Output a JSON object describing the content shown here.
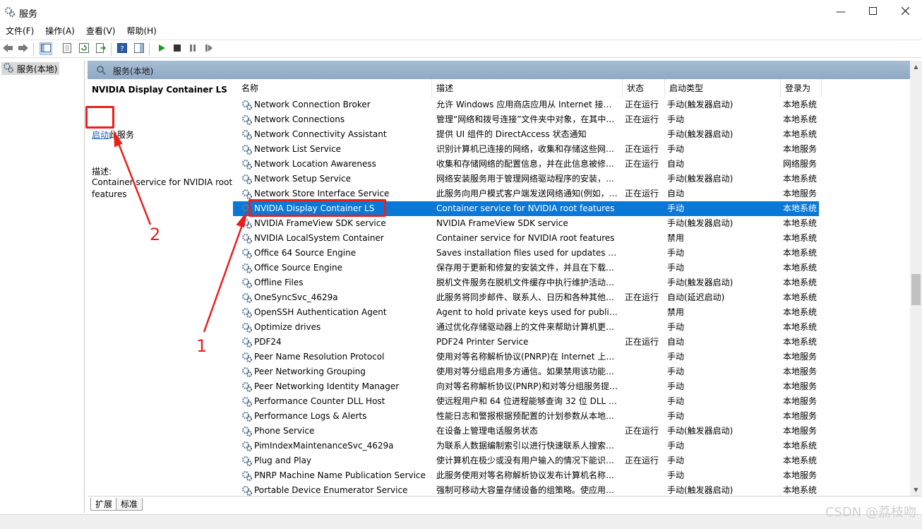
{
  "window": {
    "title": "服务"
  },
  "menu": [
    "文件(F)",
    "操作(A)",
    "查看(V)",
    "帮助(H)"
  ],
  "tree": {
    "root": "服务(本地)"
  },
  "main_header": "服务(本地)",
  "detail": {
    "title": "NVIDIA Display Container LS",
    "action_link": "启动",
    "action_suffix": "此服务",
    "desc_label": "描述:",
    "desc_text": "Container service for NVIDIA root features"
  },
  "columns": [
    "名称",
    "描述",
    "状态",
    "启动类型",
    "登录为"
  ],
  "services": [
    {
      "name": "Network Connection Broker",
      "desc": "允许 Windows 应用商店应用从 Internet 接收…",
      "status": "正在运行",
      "startup": "手动(触发器启动)",
      "logon": "本地系统"
    },
    {
      "name": "Network Connections",
      "desc": "管理“网络和拨号连接”文件夹中对象，在其中…",
      "status": "正在运行",
      "startup": "手动",
      "logon": "本地系统"
    },
    {
      "name": "Network Connectivity Assistant",
      "desc": "提供 UI 组件的 DirectAccess 状态通知",
      "status": "",
      "startup": "手动(触发器启动)",
      "logon": "本地系统"
    },
    {
      "name": "Network List Service",
      "desc": "识别计算机已连接的网络，收集和存储这些网…",
      "status": "正在运行",
      "startup": "手动",
      "logon": "本地服务"
    },
    {
      "name": "Network Location Awareness",
      "desc": "收集和存储网络的配置信息，并在此信息被修…",
      "status": "正在运行",
      "startup": "自动",
      "logon": "网络服务"
    },
    {
      "name": "Network Setup Service",
      "desc": "网络安装服务用于管理网络驱动程序的安装，…",
      "status": "",
      "startup": "手动(触发器启动)",
      "logon": "本地系统"
    },
    {
      "name": "Network Store Interface Service",
      "desc": "此服务向用户模式客户端发送网络通知(例如，…",
      "status": "正在运行",
      "startup": "自动",
      "logon": "本地服务"
    },
    {
      "name": "NVIDIA Display Container LS",
      "desc": "Container service for NVIDIA root features",
      "status": "",
      "startup": "手动",
      "logon": "本地系统",
      "selected": true
    },
    {
      "name": "NVIDIA FrameView SDK service",
      "desc": "NVIDIA FrameView SDK service",
      "status": "",
      "startup": "手动(触发器启动)",
      "logon": "本地系统"
    },
    {
      "name": "NVIDIA LocalSystem Container",
      "desc": "Container service for NVIDIA root features",
      "status": "",
      "startup": "禁用",
      "logon": "本地系统"
    },
    {
      "name": "Office 64 Source Engine",
      "desc": "Saves installation files used for updates a…",
      "status": "",
      "startup": "手动",
      "logon": "本地系统"
    },
    {
      "name": "Office Source Engine",
      "desc": "保存用于更新和修复的安装文件，并且在下载…",
      "status": "",
      "startup": "手动",
      "logon": "本地系统"
    },
    {
      "name": "Offline Files",
      "desc": "脱机文件服务在脱机文件缓存中执行维护活动…",
      "status": "",
      "startup": "手动(触发器启动)",
      "logon": "本地系统"
    },
    {
      "name": "OneSyncSvc_4629a",
      "desc": "此服务将同步邮件、联系人、日历和各种其他…",
      "status": "正在运行",
      "startup": "自动(延迟启动)",
      "logon": "本地系统"
    },
    {
      "name": "OpenSSH Authentication Agent",
      "desc": "Agent to hold private keys used for public…",
      "status": "",
      "startup": "禁用",
      "logon": "本地系统"
    },
    {
      "name": "Optimize drives",
      "desc": "通过优化存储驱动器上的文件来帮助计算机更…",
      "status": "",
      "startup": "手动",
      "logon": "本地系统"
    },
    {
      "name": "PDF24",
      "desc": "PDF24 Printer Service",
      "status": "正在运行",
      "startup": "自动",
      "logon": "本地系统"
    },
    {
      "name": "Peer Name Resolution Protocol",
      "desc": "使用对等名称解析协议(PNRP)在 Internet 上…",
      "status": "",
      "startup": "手动",
      "logon": "本地服务"
    },
    {
      "name": "Peer Networking Grouping",
      "desc": "使用对等分组启用多方通信。如果禁用该功能…",
      "status": "",
      "startup": "手动",
      "logon": "本地服务"
    },
    {
      "name": "Peer Networking Identity Manager",
      "desc": "向对等名称解析协议(PNRP)和对等分组服务提…",
      "status": "",
      "startup": "手动",
      "logon": "本地服务"
    },
    {
      "name": "Performance Counter DLL Host",
      "desc": "使远程用户和 64 位进程能够查询 32 位 DLL …",
      "status": "",
      "startup": "手动",
      "logon": "本地服务"
    },
    {
      "name": "Performance Logs & Alerts",
      "desc": "性能日志和警报根据预配置的计划参数从本地…",
      "status": "",
      "startup": "手动",
      "logon": "本地服务"
    },
    {
      "name": "Phone Service",
      "desc": "在设备上管理电话服务状态",
      "status": "正在运行",
      "startup": "手动(触发器启动)",
      "logon": "本地服务"
    },
    {
      "name": "PimIndexMaintenanceSvc_4629a",
      "desc": "为联系人数据编制索引以进行快速联系人搜索…",
      "status": "",
      "startup": "手动",
      "logon": "本地系统"
    },
    {
      "name": "Plug and Play",
      "desc": "使计算机在极少或没有用户输入的情况下能识…",
      "status": "正在运行",
      "startup": "手动",
      "logon": "本地系统"
    },
    {
      "name": "PNRP Machine Name Publication Service",
      "desc": "此服务使用对等名称解析协议发布计算机名称…",
      "status": "",
      "startup": "手动",
      "logon": "本地服务"
    },
    {
      "name": "Portable Device Enumerator Service",
      "desc": "强制可移动大容量存储设备的组策略。使应用…",
      "status": "",
      "startup": "手动(触发器启动)",
      "logon": "本地系统"
    }
  ],
  "tabs": [
    "扩展",
    "标准"
  ],
  "annotations": [
    "1",
    "2"
  ],
  "watermark": "CSDN @荔枝吻",
  "colors": {
    "selection": "#0a78d7",
    "annotation": "#e8201c",
    "header_gradient": "#a9bdd4"
  }
}
